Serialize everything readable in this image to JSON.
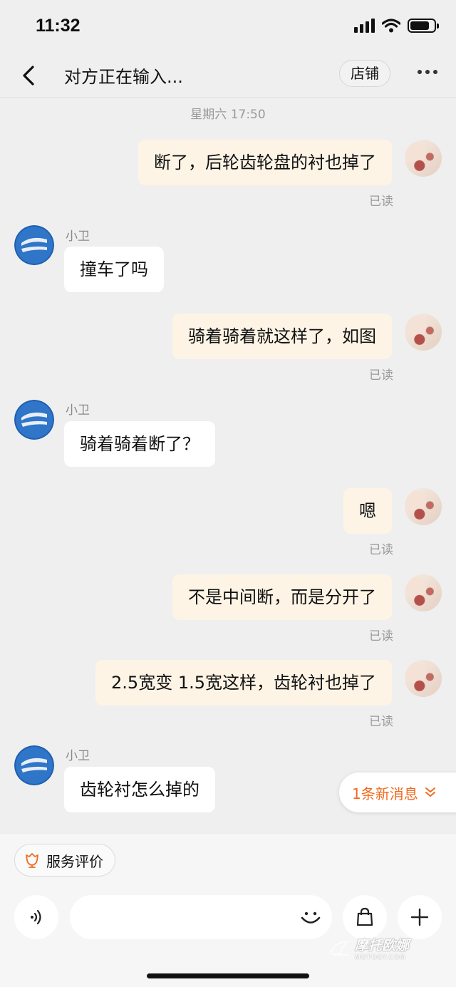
{
  "status_bar": {
    "time": "11:32"
  },
  "nav": {
    "title": "对方正在输入...",
    "shop_label": "店铺"
  },
  "timestamp": "星期六 17:50",
  "messages": [
    {
      "sender": "me",
      "text": "断了，后轮齿轮盘的衬也掉了",
      "read": "已读"
    },
    {
      "sender": "them",
      "name": "小卫",
      "text": "撞车了吗"
    },
    {
      "sender": "me",
      "text": "骑着骑着就这样了，如图",
      "read": "已读"
    },
    {
      "sender": "them",
      "name": "小卫",
      "text": "骑着骑着断了？"
    },
    {
      "sender": "me",
      "text": "嗯",
      "read": "已读"
    },
    {
      "sender": "me",
      "text": "不是中间断，而是分开了",
      "read": "已读"
    },
    {
      "sender": "me",
      "text": "2.5宽变 1.5宽这样，齿轮衬也掉了",
      "read": "已读"
    },
    {
      "sender": "them",
      "name": "小卫",
      "text": "齿轮衬怎么掉的"
    }
  ],
  "new_messages": "1条新消息",
  "bottom": {
    "service_rating": "服务评价"
  },
  "watermark": {
    "text": "摩托欧娜",
    "sub": "MOTOOY.COM"
  },
  "colors": {
    "accent": "#f06a1f",
    "my_bubble": "#fdf4e6",
    "their_bubble": "#ffffff",
    "background": "#efefef"
  }
}
